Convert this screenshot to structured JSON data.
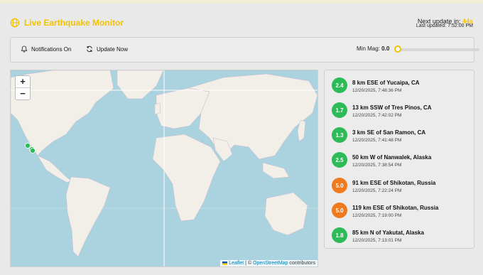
{
  "header": {
    "title": "Live Earthquake Monitor",
    "next_update_label": "Next update in:",
    "next_update_value": "44s",
    "last_updated": "Last updated: 7:52:00 PM"
  },
  "controls": {
    "notifications_label": "Notifications On",
    "update_label": "Update Now",
    "min_mag_label": "Min Mag:",
    "min_mag_value": "0.0",
    "min_mag_fraction": 0
  },
  "map": {
    "zoom_in": "+",
    "zoom_out": "−",
    "attribution_leaflet": "Leaflet",
    "attribution_sep": " | © ",
    "attribution_osm": "OpenStreetMap",
    "attribution_tail": " contributors"
  },
  "colors": {
    "accent": "#f2c200",
    "mag_low": "#2dbb57",
    "mag_high": "#f07b1e"
  },
  "quakes": [
    {
      "mag": "2.4",
      "place": "8 km ESE of Yucaipa, CA",
      "time": "12/20/2025, 7:48:36 PM",
      "level": "low"
    },
    {
      "mag": "1.7",
      "place": "13 km SSW of Tres Pinos, CA",
      "time": "12/20/2025, 7:42:02 PM",
      "level": "low"
    },
    {
      "mag": "1.3",
      "place": "3 km SE of San Ramon, CA",
      "time": "12/20/2025, 7:41:48 PM",
      "level": "low"
    },
    {
      "mag": "2.5",
      "place": "50 km W of Nanwalek, Alaska",
      "time": "12/20/2025, 7:38:54 PM",
      "level": "low"
    },
    {
      "mag": "5.0",
      "place": "91 km ESE of Shikotan, Russia",
      "time": "12/20/2025, 7:22:24 PM",
      "level": "high"
    },
    {
      "mag": "5.0",
      "place": "119 km ESE of Shikotan, Russia",
      "time": "12/20/2025, 7:19:00 PM",
      "level": "high"
    },
    {
      "mag": "1.8",
      "place": "85 km N of Yakutat, Alaska",
      "time": "12/20/2025, 7:13:01 PM",
      "level": "low"
    }
  ]
}
